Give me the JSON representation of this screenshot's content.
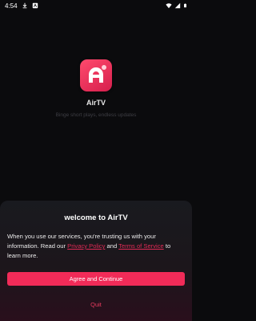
{
  "status_bar": {
    "time": "4:54"
  },
  "app": {
    "name": "AirTV",
    "tagline": "Binge short plays, endless updates"
  },
  "dialog": {
    "title": "welcome to AirTV",
    "body_start": "When you use our services, you're trusting us with your information. Read our ",
    "privacy_link": "Privacy Policy",
    "body_and": " and ",
    "terms_link": "Terms of Service",
    "body_end": " to learn more.",
    "agree_label": "Agree and Continue",
    "quit_label": "Quit"
  },
  "colors": {
    "accent": "#f12b58",
    "link": "#e02a55",
    "background": "#0b0b0d"
  }
}
